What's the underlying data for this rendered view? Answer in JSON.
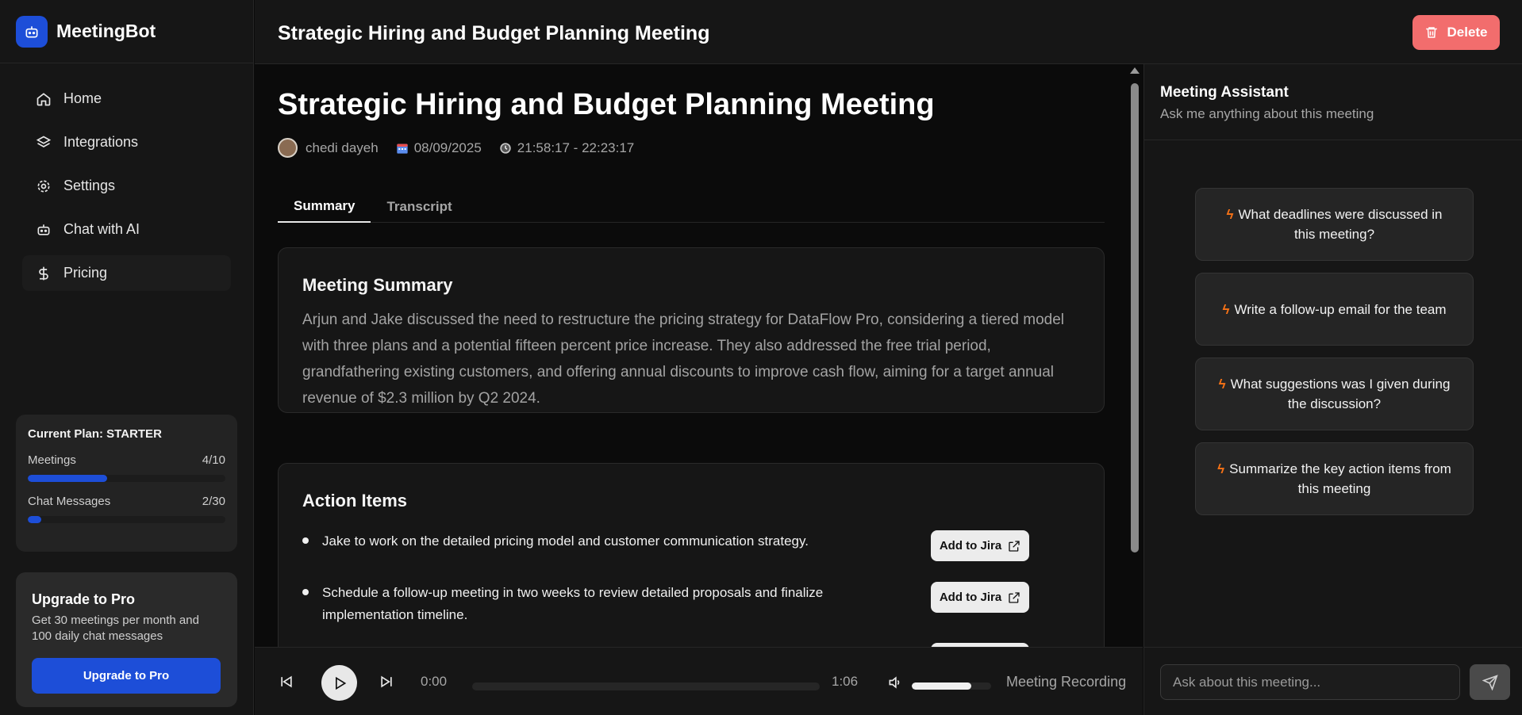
{
  "app": {
    "name": "MeetingBot",
    "accent": "#1d4ed8"
  },
  "sidebar": {
    "items": [
      {
        "label": "Home",
        "icon": "home-icon"
      },
      {
        "label": "Integrations",
        "icon": "layers-icon"
      },
      {
        "label": "Settings",
        "icon": "gear-icon"
      },
      {
        "label": "Chat with AI",
        "icon": "bot-icon"
      },
      {
        "label": "Pricing",
        "icon": "dollar-icon"
      }
    ],
    "active": "Pricing",
    "plan": {
      "title": "Current Plan: STARTER",
      "meetings_label": "Meetings",
      "meetings_value": "4/10",
      "meetings_fraction": 0.4,
      "chat_label": "Chat Messages",
      "chat_value": "2/30",
      "chat_fraction": 0.067
    },
    "upgrade": {
      "title": "Upgrade to Pro",
      "description": "Get 30 meetings per month and 100 daily chat messages",
      "button": "Upgrade to Pro"
    }
  },
  "header": {
    "title": "Strategic Hiring and Budget Planning Meeting",
    "delete_label": "Delete",
    "delete_color": "#f26d6d"
  },
  "meeting": {
    "title": "Strategic Hiring and Budget Planning Meeting",
    "author": "chedi dayeh",
    "date": "08/09/2025",
    "time_range": "21:58:17 - 22:23:17"
  },
  "tabs": [
    {
      "label": "Summary",
      "active": true
    },
    {
      "label": "Transcript",
      "active": false
    }
  ],
  "summary": {
    "title": "Meeting Summary",
    "text": "Arjun and Jake discussed the need to restructure the pricing strategy for DataFlow Pro, considering a tiered model with three plans and a potential fifteen percent price increase. They also addressed the free trial period, grandfathering existing customers, and offering annual discounts to improve cash flow, aiming for a target annual revenue of $2.3 million by Q2 2024."
  },
  "actions": {
    "title": "Action Items",
    "button_label": "Add to Jira",
    "items": [
      "Jake to work on the detailed pricing model and customer communication strategy.",
      "Schedule a follow-up meeting in two weeks to review detailed proposals and finalize implementation timeline."
    ]
  },
  "player": {
    "current_time": "0:00",
    "duration": "1:06",
    "progress": 0,
    "volume": 0.75,
    "label": "Meeting Recording"
  },
  "assistant": {
    "title": "Meeting Assistant",
    "subtitle": "Ask me anything about this meeting",
    "suggestions": [
      "What deadlines were discussed in this meeting?",
      "Write a follow-up email for the team",
      "What suggestions was I given during the discussion?",
      "Summarize the key action items from this meeting"
    ],
    "input_placeholder": "Ask about this meeting..."
  }
}
